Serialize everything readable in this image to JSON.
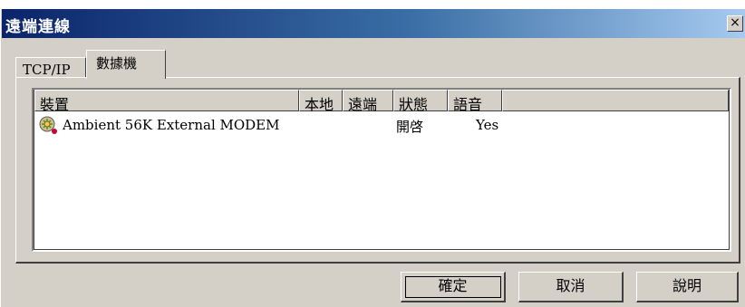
{
  "window": {
    "title": "遠端連線",
    "close_glyph": "×"
  },
  "tabs": [
    {
      "label": "TCP/IP",
      "active": false
    },
    {
      "label": "數據機",
      "active": true
    }
  ],
  "list": {
    "columns": [
      "裝置",
      "本地",
      "遠端",
      "狀態",
      "語音"
    ],
    "rows": [
      {
        "icon": "modem-icon",
        "device": "Ambient 56K External MODEM",
        "local": "",
        "remote": "",
        "state": "開啓",
        "voice": "Yes"
      }
    ]
  },
  "buttons": {
    "ok": "確定",
    "cancel": "取消",
    "help": "說明"
  }
}
